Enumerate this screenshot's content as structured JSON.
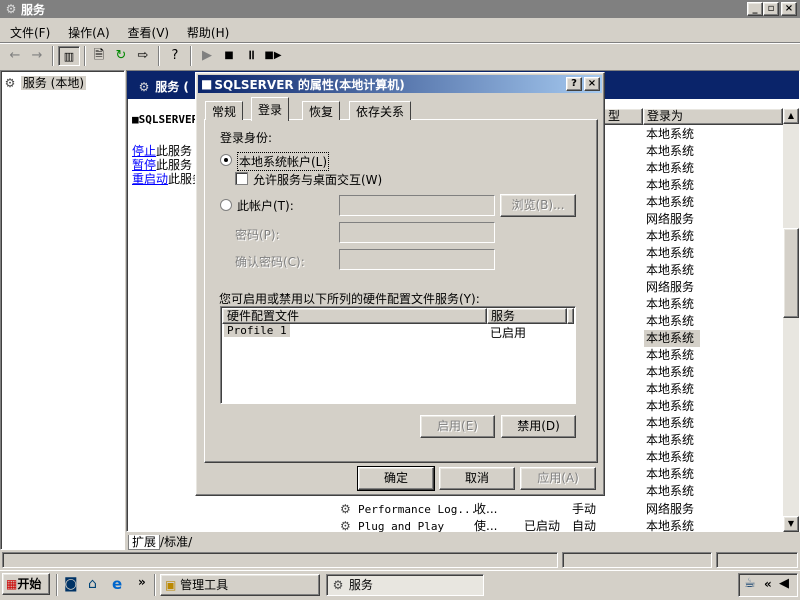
{
  "window": {
    "title": "服务"
  },
  "menu": {
    "items": [
      "文件(F)",
      "操作(A)",
      "查看(V)",
      "帮助(H)"
    ]
  },
  "tree": {
    "root": "服务 (本地)"
  },
  "panel": {
    "header_prefix": "服务 (",
    "service_name": "SQLSERVER",
    "links": [
      {
        "link": "停止",
        "rest": "此服务"
      },
      {
        "link": "暂停",
        "rest": "此服务"
      },
      {
        "link": "重启动",
        "rest": "此服务"
      }
    ],
    "bottom_tabs": [
      "扩展",
      "标准"
    ]
  },
  "list": {
    "col_type_header": "型",
    "col_logon_header": "登录为",
    "logon_values": [
      "本地系统",
      "本地系统",
      "本地系统",
      "本地系统",
      "本地系统",
      "网络服务",
      "本地系统",
      "本地系统",
      "本地系统",
      "网络服务",
      "本地系统",
      "本地系统",
      "本地系统",
      "本地系统",
      "本地系统",
      "本地系统",
      "本地系统",
      "本地系统",
      "本地系统",
      "本地系统",
      "本地系统",
      "本地系统"
    ],
    "selected_index": 12,
    "bottom_rows": [
      {
        "name": "Performance Log...",
        "desc": "收...",
        "status": "",
        "startup": "手动",
        "logon": "网络服务"
      },
      {
        "name": "Plug and Play",
        "desc": "使...",
        "status": "已启动",
        "startup": "自动",
        "logon": "本地系统"
      }
    ]
  },
  "dialog": {
    "title": "SQLSERVER 的属性(本地计算机)",
    "tabs": [
      "常规",
      "登录",
      "恢复",
      "依存关系"
    ],
    "active_tab": 1,
    "logon_as_label": "登录身份:",
    "local_system_label": "本地系统帐户(L)",
    "interact_label": "允许服务与桌面交互(W)",
    "this_account_label": "此帐户(T):",
    "browse_label": "浏览(B)...",
    "password_label": "密码(P):",
    "confirm_password_label": "确认密码(C):",
    "hw_profile_caption": "您可启用或禁用以下所列的硬件配置文件服务(Y):",
    "hw_columns": [
      "硬件配置文件",
      "服务"
    ],
    "hw_rows": [
      {
        "profile": "Profile 1",
        "service": "已启用"
      }
    ],
    "enable_label": "启用(E)",
    "disable_label": "禁用(D)",
    "ok_label": "确定",
    "cancel_label": "取消",
    "apply_label": "应用(A)",
    "help_glyph": "?",
    "close_glyph": "×"
  },
  "taskbar": {
    "start_label": "开始",
    "chevron": "»",
    "tasks": [
      "管理工具",
      "服务"
    ],
    "tray_chevron": "«"
  },
  "colors": {
    "title_active": "#0a246a",
    "title_inactive": "#808080",
    "face": "#d4d0c8",
    "link": "#0000ff"
  }
}
